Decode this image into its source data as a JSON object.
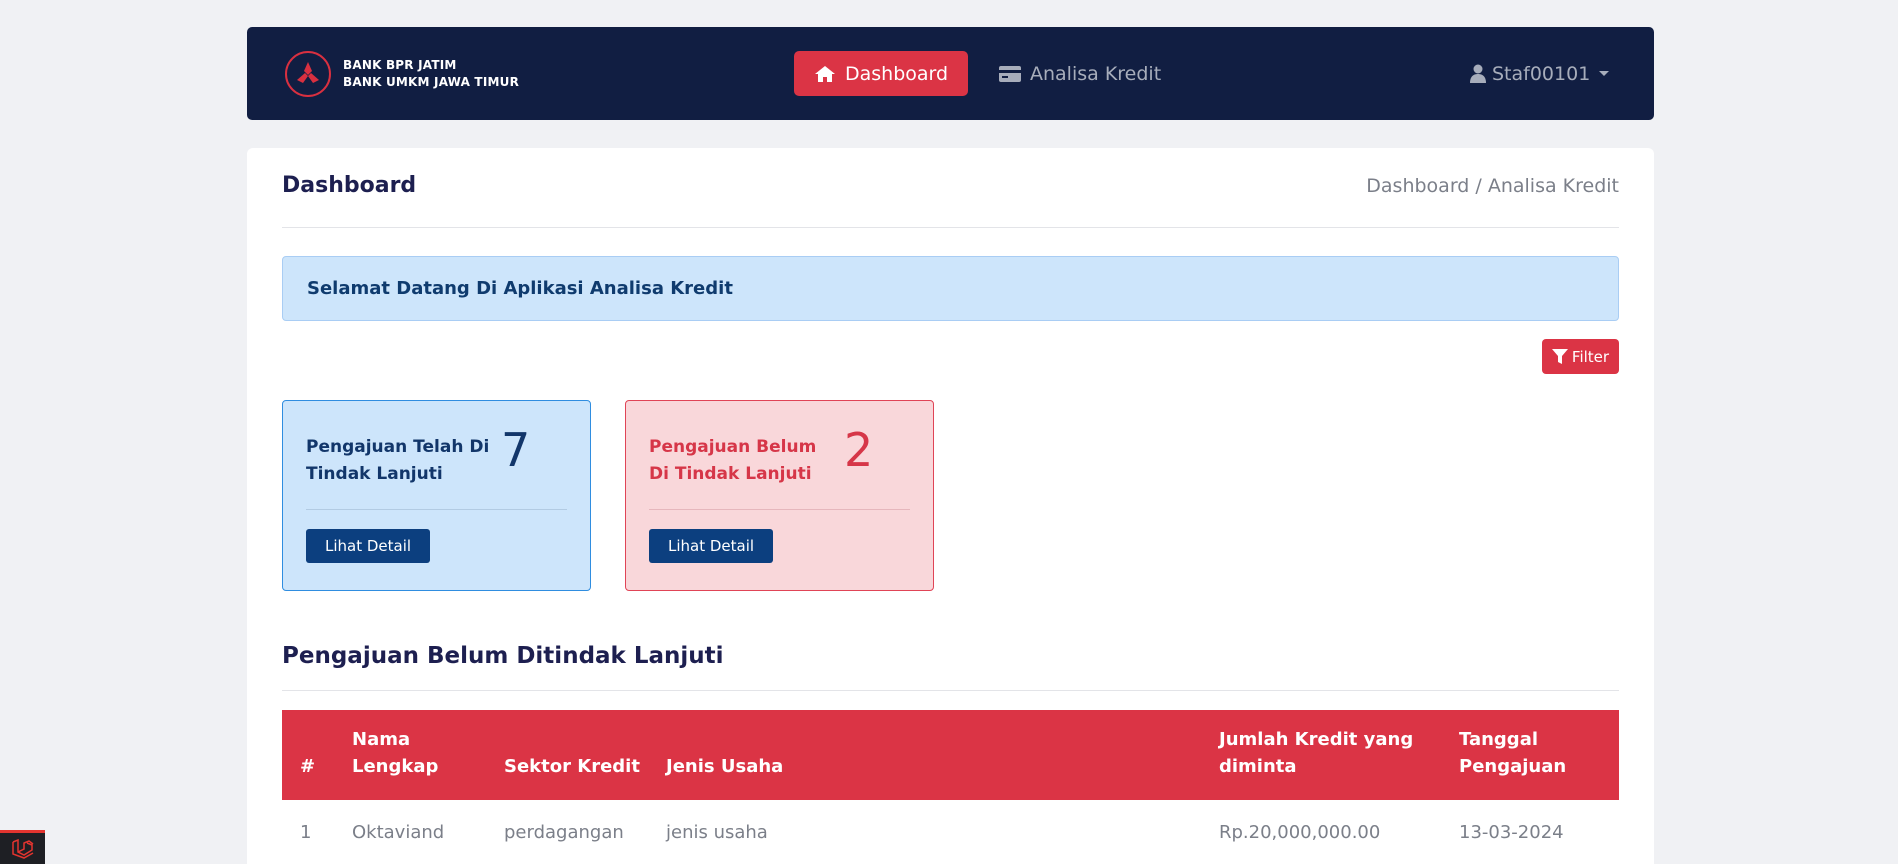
{
  "navbar": {
    "brand_line1": "BANK BPR JATIM",
    "brand_line2": "BANK UMKM JAWA TIMUR",
    "dashboard_label": "Dashboard",
    "analisa_label": "Analisa Kredit",
    "user_label": "Staf00101"
  },
  "header": {
    "title": "Dashboard",
    "breadcrumb": "Dashboard / Analisa Kredit"
  },
  "alert": {
    "text": "Selamat Datang Di Aplikasi Analisa Kredit"
  },
  "filter": {
    "label": "Filter"
  },
  "stats": [
    {
      "label": "Pengajuan Telah Di Tindak Lanjuti",
      "value": "7",
      "button": "Lihat Detail"
    },
    {
      "label": "Pengajuan Belum Di Tindak Lanjuti",
      "value": "2",
      "button": "Lihat Detail"
    }
  ],
  "section": {
    "title": "Pengajuan Belum Ditindak Lanjuti"
  },
  "table": {
    "columns": [
      "#",
      "Nama Lengkap",
      "Sektor Kredit",
      "Jenis Usaha",
      "Jumlah Kredit yang diminta",
      "Tanggal Pengajuan"
    ],
    "rows": [
      [
        "1",
        "Oktaviand",
        "perdagangan",
        "jenis usaha",
        "Rp.20,000,000.00",
        "13-03-2024"
      ]
    ]
  },
  "colors": {
    "navbar_bg": "#111e42",
    "accent_red": "#db3445",
    "primary_blue": "#0c3f7f",
    "info_bg": "#cde5fb",
    "danger_bg": "#f9d7da"
  },
  "icons": {
    "home": "home-icon",
    "card": "credit-card-icon",
    "user": "user-icon",
    "filter": "filter-icon",
    "logo": "bank-logo-icon",
    "laravel": "laravel-icon"
  }
}
